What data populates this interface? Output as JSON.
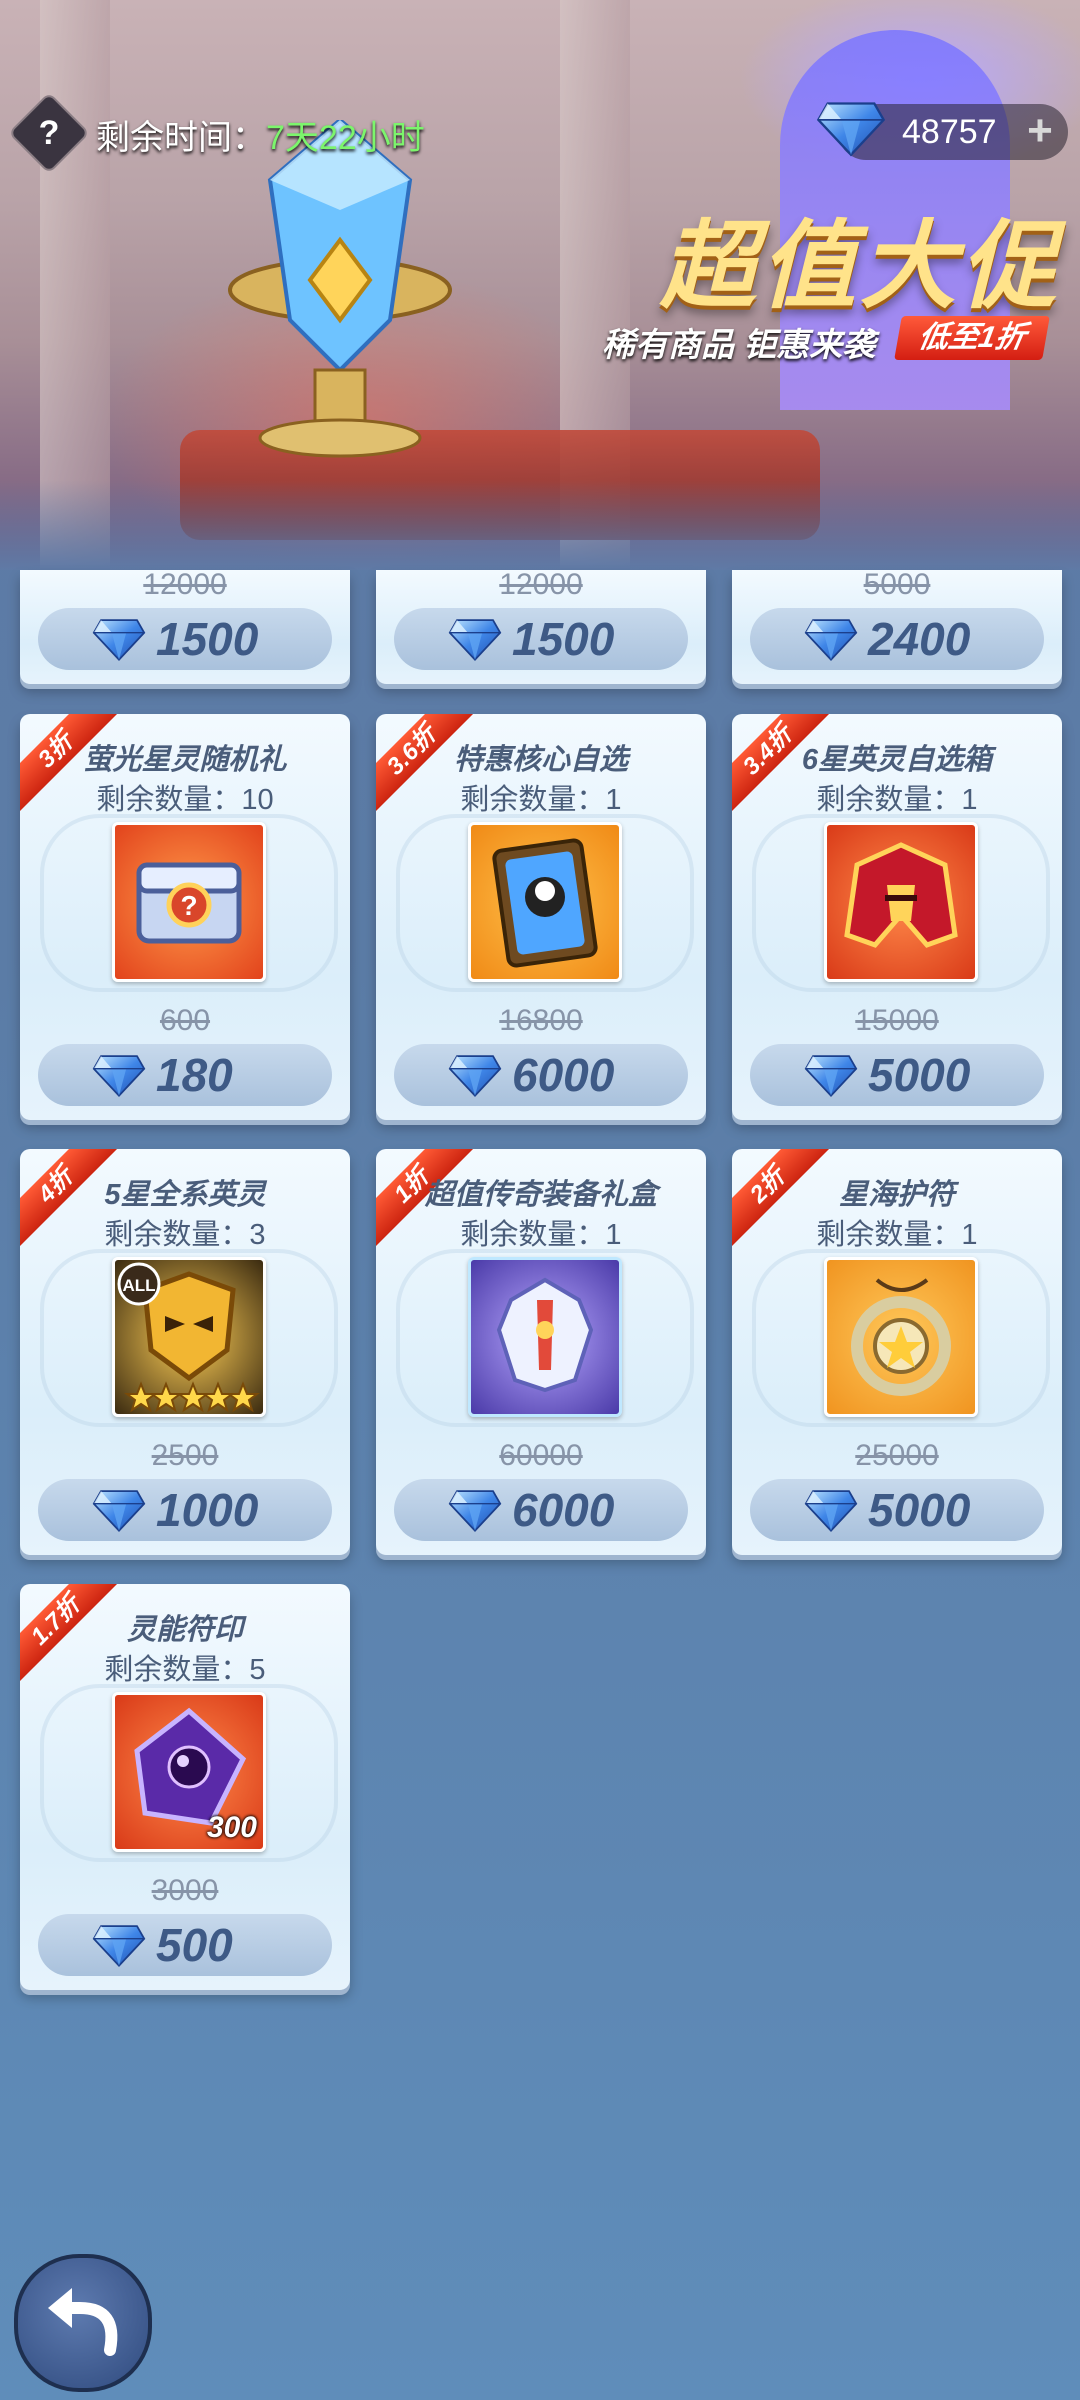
{
  "header": {
    "help_icon_text": "?",
    "timer_label": "剩余时间：",
    "timer_value": "7天22小时",
    "currency_amount": "48757",
    "currency_plus": "+",
    "promo_title": "超值大促",
    "promo_subtitle": "稀有商品 钜惠来袭",
    "promo_tag": "低至1折"
  },
  "top_row": [
    {
      "old_price": "12000",
      "price": "1500"
    },
    {
      "old_price": "12000",
      "price": "1500"
    },
    {
      "old_price": "5000",
      "price": "2400"
    }
  ],
  "items": [
    {
      "discount": "3折",
      "title": "萤光星灵随机礼",
      "remain": "剩余数量：10",
      "old_price": "600",
      "price": "180",
      "icon": "chest-icon"
    },
    {
      "discount": "3.6折",
      "title": "特惠核心自选",
      "remain": "剩余数量：1",
      "old_price": "16800",
      "price": "6000",
      "icon": "core-card-icon"
    },
    {
      "discount": "3.4折",
      "title": "6星英灵自选箱",
      "remain": "剩余数量：1",
      "old_price": "15000",
      "price": "5000",
      "icon": "helmet-icon"
    },
    {
      "discount": "4折",
      "title": "5星全系英灵",
      "remain": "剩余数量：3",
      "old_price": "2500",
      "price": "1000",
      "icon": "mask-all-icon",
      "badge": "ALL"
    },
    {
      "discount": "1折",
      "title": "超值传奇装备礼盒",
      "remain": "剩余数量：1",
      "old_price": "60000",
      "price": "6000",
      "icon": "armor-icon"
    },
    {
      "discount": "2折",
      "title": "星海护符",
      "remain": "剩余数量：1",
      "old_price": "25000",
      "price": "5000",
      "icon": "amulet-icon"
    },
    {
      "discount": "1.7折",
      "title": "灵能符印",
      "remain": "剩余数量：5",
      "old_price": "3000",
      "price": "500",
      "icon": "sigil-icon",
      "count": "300"
    }
  ],
  "colors": {
    "accent_text": "#7cf56c",
    "promo_gold": "#ffe38a",
    "ribbon_red": "#cc2410",
    "price_text": "#3e5a86"
  }
}
